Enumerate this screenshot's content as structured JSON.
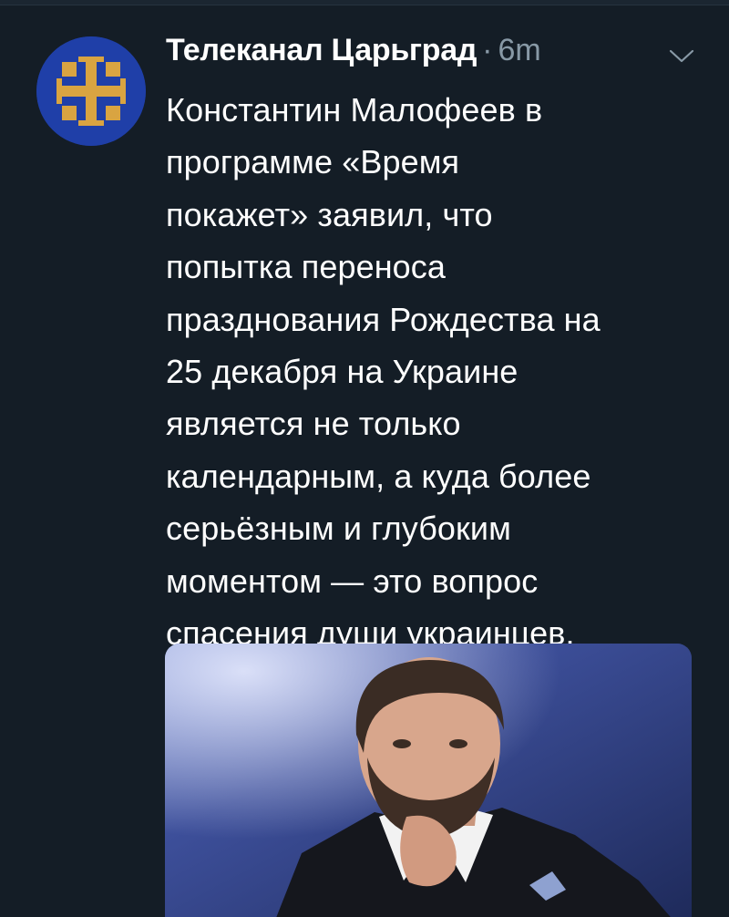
{
  "tweet": {
    "author_name": "Телеканал Царьград",
    "separator": "·",
    "timestamp": "6m",
    "text": "Константин Малофеев в\nпрограмме «Время\nпокажет» заявил, что\nпопытка переноса\nпразднования Рождества на\n25 декабря на Украине\nявляется не только\nкалендарным, а куда более\nсерьёзным и глубоким\nмоментом — это вопрос\nспасения души украинцев.",
    "avatar_icon": "tsargrad-cross-logo-icon",
    "menu_icon": "chevron-down-icon",
    "media_subject": "photo"
  },
  "colors": {
    "background": "#141d26",
    "secondary_text": "#8899a6",
    "avatar_bg": "#1f3fa8",
    "logo_gold": "#d9a441"
  }
}
